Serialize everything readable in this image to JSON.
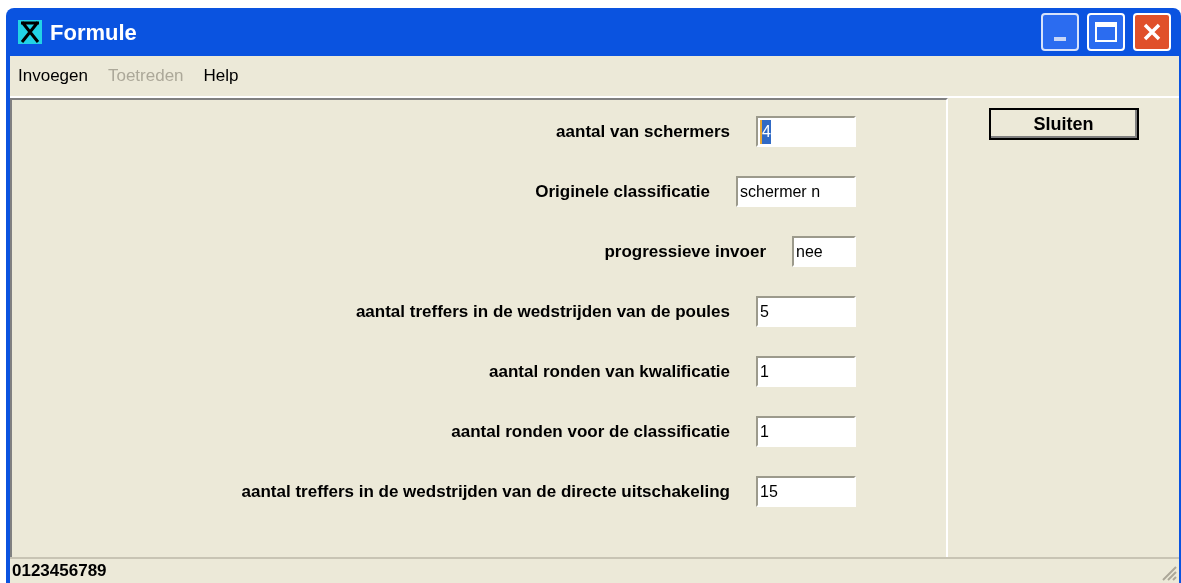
{
  "window": {
    "title": "Formule"
  },
  "menu": [
    {
      "label": "Invoegen",
      "disabled": false
    },
    {
      "label": "Toetreden",
      "disabled": true
    },
    {
      "label": "Help",
      "disabled": false
    }
  ],
  "fields": [
    {
      "label": "aantal van schermers",
      "value": "4",
      "selected": true
    },
    {
      "label": "Originele classificatie",
      "value": "schermer n",
      "selected": false
    },
    {
      "label": "progressieve invoer",
      "value": "nee",
      "selected": false
    },
    {
      "label": "aantal treffers in de wedstrijden van de poules",
      "value": "5",
      "selected": false
    },
    {
      "label": "aantal ronden van kwalificatie",
      "value": "1",
      "selected": false
    },
    {
      "label": "aantal ronden voor de classificatie",
      "value": "1",
      "selected": false
    },
    {
      "label": "aantal treffers in de wedstrijden van de directe uitschakeling",
      "value": "15",
      "selected": false
    }
  ],
  "close_button": "Sluiten",
  "status_bar": "0123456789"
}
